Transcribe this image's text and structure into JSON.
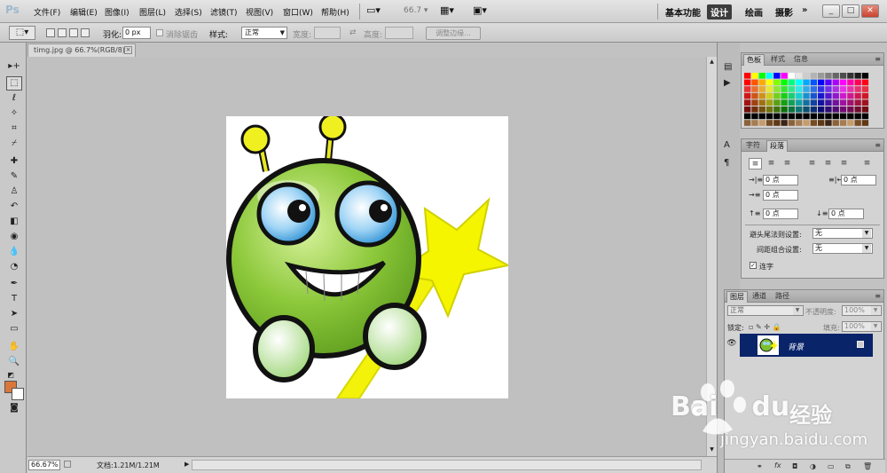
{
  "app": {
    "logo": "Ps",
    "menu": [
      "文件(F)",
      "编辑(E)",
      "图像(I)",
      "图层(L)",
      "选择(S)",
      "滤镜(T)",
      "视图(V)",
      "窗口(W)",
      "帮助(H)"
    ],
    "zoom_combo": "66.7",
    "workspaces": [
      "基本功能",
      "设计",
      "绘画",
      "摄影"
    ],
    "active_workspace": "设计",
    "more": "»",
    "win_min": "_",
    "win_restore": "□",
    "win_close": "✕"
  },
  "options": {
    "feather_label": "羽化:",
    "feather_value": "0 px",
    "antialias_label": "消除锯齿",
    "style_label": "样式:",
    "style_value": "正常",
    "width_label": "宽度:",
    "height_label": "高度:",
    "refine_edge": "调整边缘..."
  },
  "document": {
    "tab_title": "timg.jpg @ 66.7%(RGB/8)",
    "close": "×",
    "zoom": "66.67%",
    "doc_info": "文档:1.21M/1.21M"
  },
  "swatches": {
    "tabs": [
      "色板",
      "样式",
      "信息"
    ],
    "active_tab": "色板"
  },
  "paragraph": {
    "tabs": [
      "字符",
      "段落"
    ],
    "active_tab": "段落",
    "indent_left": "0 点",
    "indent_right": "0 点",
    "indent_first": "0 点",
    "space_before": "0 点",
    "space_after": "0 点",
    "kinsoku_label": "避头尾法则设置:",
    "kinsoku_value": "无",
    "mojikumi_label": "间距组合设置:",
    "mojikumi_value": "无",
    "hyphenate_label": "连字"
  },
  "layers": {
    "tabs": [
      "图层",
      "通道",
      "路径"
    ],
    "active_tab": "图层",
    "blend_mode": "正常",
    "opacity_label": "不透明度:",
    "opacity_value": "100%",
    "lock_label": "锁定:",
    "fill_label": "填充:",
    "fill_value": "100%",
    "layer_name": "背景"
  },
  "watermark": {
    "brand": "Bai",
    "brand2": "du",
    "product": "经验",
    "url": "jingyan.baidu.com"
  },
  "colors": {
    "foreground": "#d9773b",
    "background": "#ffffff",
    "layer_selected": "#0a246a"
  }
}
